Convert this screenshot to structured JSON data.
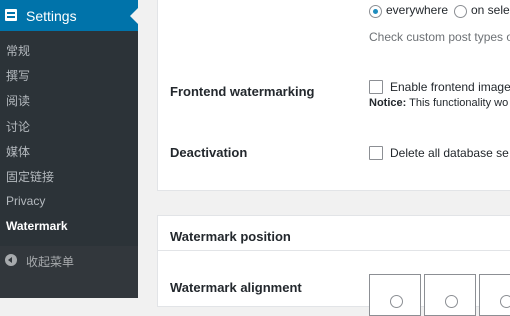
{
  "sidebar": {
    "header_title": "Settings",
    "items": [
      {
        "label": "常规"
      },
      {
        "label": "撰写"
      },
      {
        "label": "阅读"
      },
      {
        "label": "讨论"
      },
      {
        "label": "媒体"
      },
      {
        "label": "固定链接"
      },
      {
        "label": "Privacy"
      },
      {
        "label": "Watermark",
        "current": true
      }
    ],
    "collapse_label": "收起菜单"
  },
  "main": {
    "post_types": {
      "option_everywhere": "everywhere",
      "option_on_selected": "on sele",
      "selected": "everywhere",
      "help_text": "Check custom post types or"
    },
    "frontend_watermarking": {
      "label": "Frontend watermarking",
      "checkbox_label": "Enable frontend image",
      "checked": false,
      "notice_label": "Notice:",
      "notice_text": "This functionality wo"
    },
    "deactivation": {
      "label": "Deactivation",
      "checkbox_label": "Delete all database se",
      "checked": false
    },
    "watermark_position": {
      "section_title": "Watermark position",
      "alignment_label": "Watermark alignment"
    }
  }
}
